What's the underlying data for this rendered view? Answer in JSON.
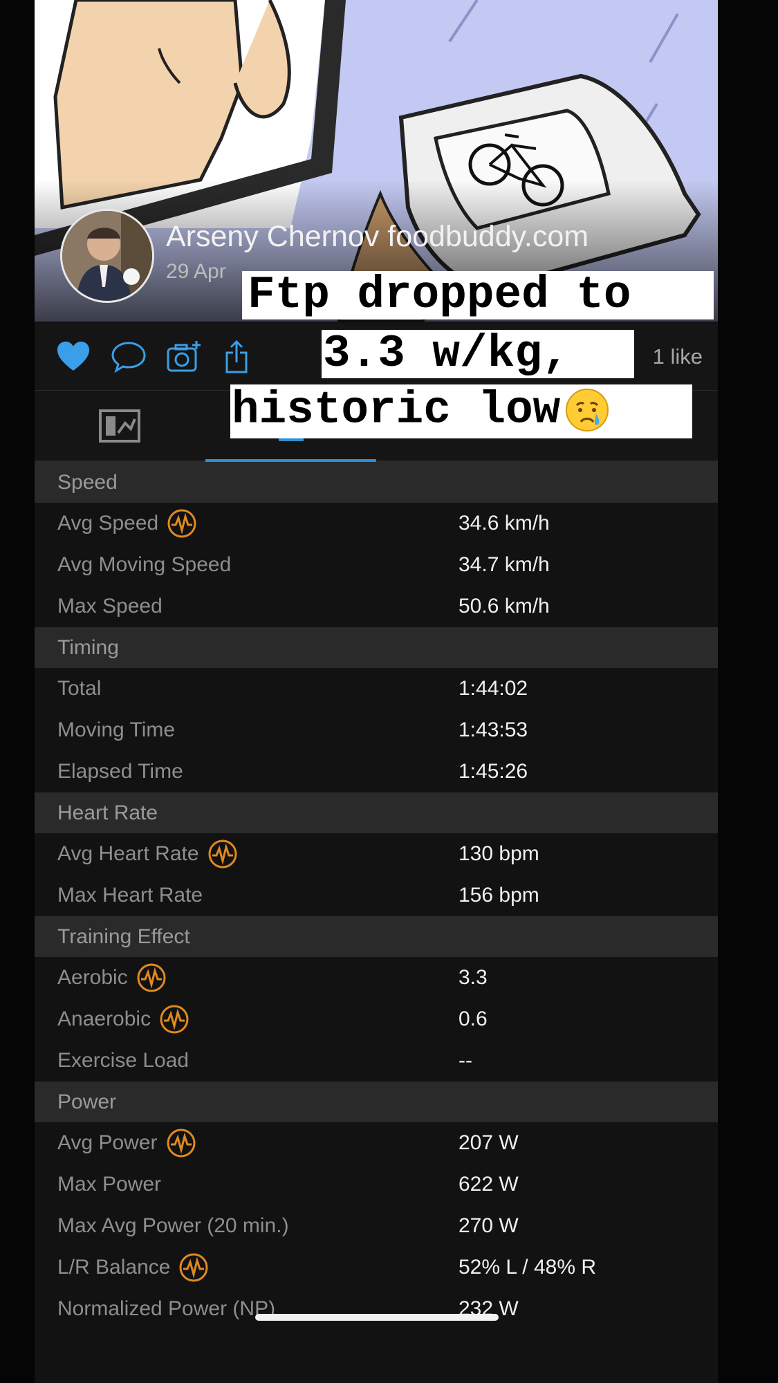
{
  "post": {
    "user_name": "Arseny Chernov foodbuddy.com",
    "date": "29 Apr",
    "likes": "1 like"
  },
  "caption": {
    "line1": "Ftp dropped to",
    "line2": "3.3 w/kg,",
    "line3": "historic low"
  },
  "actions": {
    "like_icon": "heart-icon",
    "comment_icon": "comment-icon",
    "photo_icon": "camera-add-icon",
    "share_icon": "share-icon"
  },
  "colors": {
    "accent": "#2d8fd5",
    "training_effect_icon": "#e08a1e",
    "section_bg": "#2a2a2a"
  },
  "stats": {
    "speed": {
      "title": "Speed",
      "rows": [
        {
          "label": "Avg Speed",
          "value": "34.6 km/h"
        },
        {
          "label": "Avg Moving Speed",
          "value": "34.7 km/h"
        },
        {
          "label": "Max Speed",
          "value": "50.6 km/h"
        }
      ]
    },
    "timing": {
      "title": "Timing",
      "rows": [
        {
          "label": "Total",
          "value": "1:44:02"
        },
        {
          "label": "Moving Time",
          "value": "1:43:53"
        },
        {
          "label": "Elapsed Time",
          "value": "1:45:26"
        }
      ]
    },
    "heart_rate": {
      "title": "Heart Rate",
      "rows": [
        {
          "label": "Avg Heart Rate",
          "value": "130 bpm"
        },
        {
          "label": "Max Heart Rate",
          "value": "156 bpm"
        }
      ]
    },
    "training_effect": {
      "title": "Training Effect",
      "rows": [
        {
          "label": "Aerobic",
          "value": "3.3"
        },
        {
          "label": "Anaerobic",
          "value": "0.6"
        },
        {
          "label": "Exercise Load",
          "value": "--"
        }
      ]
    },
    "power": {
      "title": "Power",
      "rows": [
        {
          "label": "Avg Power",
          "value": "207 W"
        },
        {
          "label": "Max Power",
          "value": "622 W"
        },
        {
          "label": "Max Avg Power (20 min.)",
          "value": "270 W"
        },
        {
          "label": "L/R Balance",
          "value": "52% L / 48% R"
        },
        {
          "label": "Normalized Power (NP)",
          "value": "232 W"
        }
      ]
    }
  }
}
